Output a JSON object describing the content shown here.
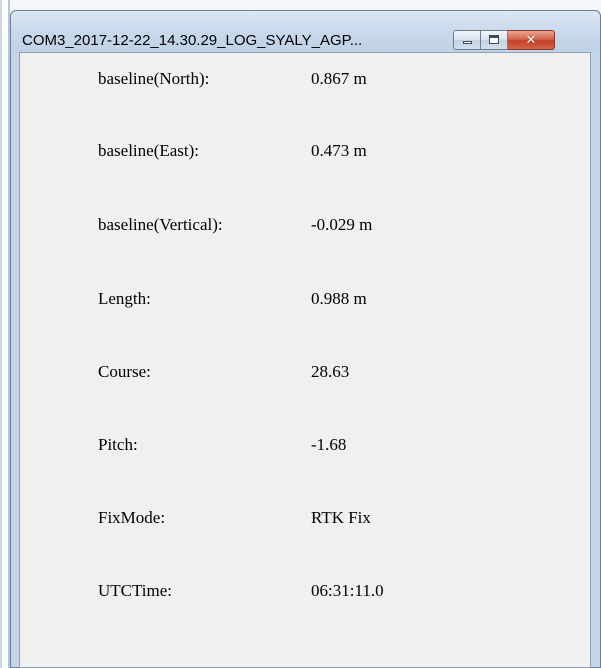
{
  "window": {
    "title": "COM3_2017-12-22_14.30.29_LOG_SYALY_AGP...",
    "controls": {
      "minimize_icon": "minimize-icon",
      "maximize_icon": "maximize-icon",
      "close_icon": "close-icon",
      "close_glyph": "✕"
    },
    "close_color": "#c7432b"
  },
  "fields": [
    {
      "label": "baseline(North):",
      "value": "0.867 m"
    },
    {
      "label": "baseline(East):",
      "value": "0.473 m"
    },
    {
      "label": "baseline(Vertical):",
      "value": "-0.029 m"
    },
    {
      "label": "Length:",
      "value": "0.988 m"
    },
    {
      "label": "Course:",
      "value": "28.63"
    },
    {
      "label": "Pitch:",
      "value": "-1.68"
    },
    {
      "label": "FixMode:",
      "value": "RTK Fix"
    },
    {
      "label": "UTCTime:",
      "value": "06:31:11.0"
    }
  ]
}
